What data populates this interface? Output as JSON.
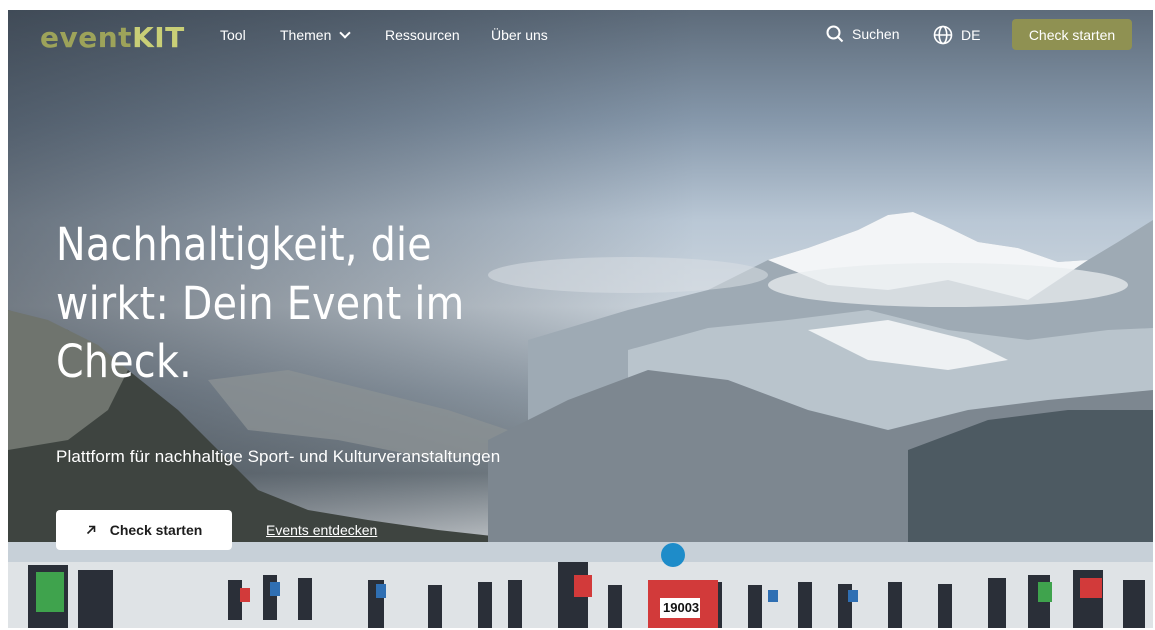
{
  "brand": {
    "logo_event": "event",
    "logo_kit": "KIT"
  },
  "nav": {
    "items": [
      {
        "label": "Tool"
      },
      {
        "label": "Themen"
      },
      {
        "label": "Ressourcen"
      },
      {
        "label": "Über uns"
      }
    ],
    "search_label": "Suchen",
    "language_label": "DE",
    "cta_label": "Check starten"
  },
  "hero": {
    "headline": "Nachhaltigkeit, die wirkt: Dein Event im Check.",
    "subline": "Plattform für nachhaltige Sport- und Kulturveranstaltungen",
    "primary_button_label": "Check starten",
    "secondary_link_label": "Events entdecken",
    "bib_number": "19003"
  },
  "colors": {
    "accent": "#8f9152",
    "logo": "#9da35a",
    "logo_kit": "#c9cf77",
    "text_on_image": "#ffffff"
  },
  "icons": {
    "search": "search-icon",
    "language": "globe-icon",
    "dropdown": "chevron-down-icon",
    "button_arrow": "arrow-up-right-icon"
  }
}
